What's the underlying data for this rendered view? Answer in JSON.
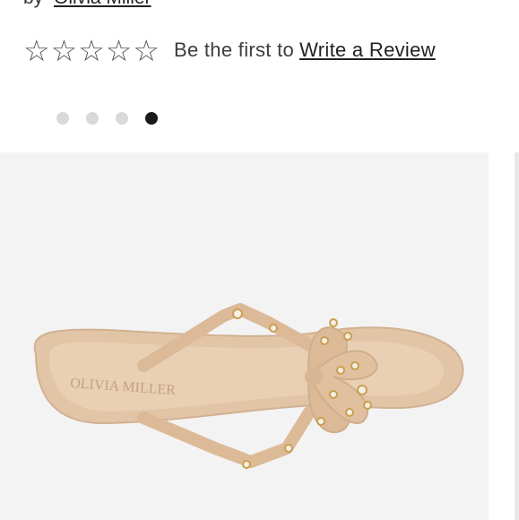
{
  "product": {
    "by_label": "by",
    "brand": "Olivia Miller",
    "image_alt": "Nude jelly flip flop sandal with pearl-studded bow",
    "sole_logo": "OLIVIA MILLER"
  },
  "reviews": {
    "star_count": 5,
    "rating": 0,
    "prompt": "Be the first to",
    "link_label": "Write a Review"
  },
  "carousel": {
    "total": 4,
    "active_index": 3
  },
  "colors": {
    "sandal": "#e2c4a6",
    "sandal_shadow": "#d2b191",
    "pearl": "#f5efe6",
    "gold": "#c9a04e",
    "active_dot": "#1a1a1a",
    "inactive_dot": "#d9d9d9"
  }
}
